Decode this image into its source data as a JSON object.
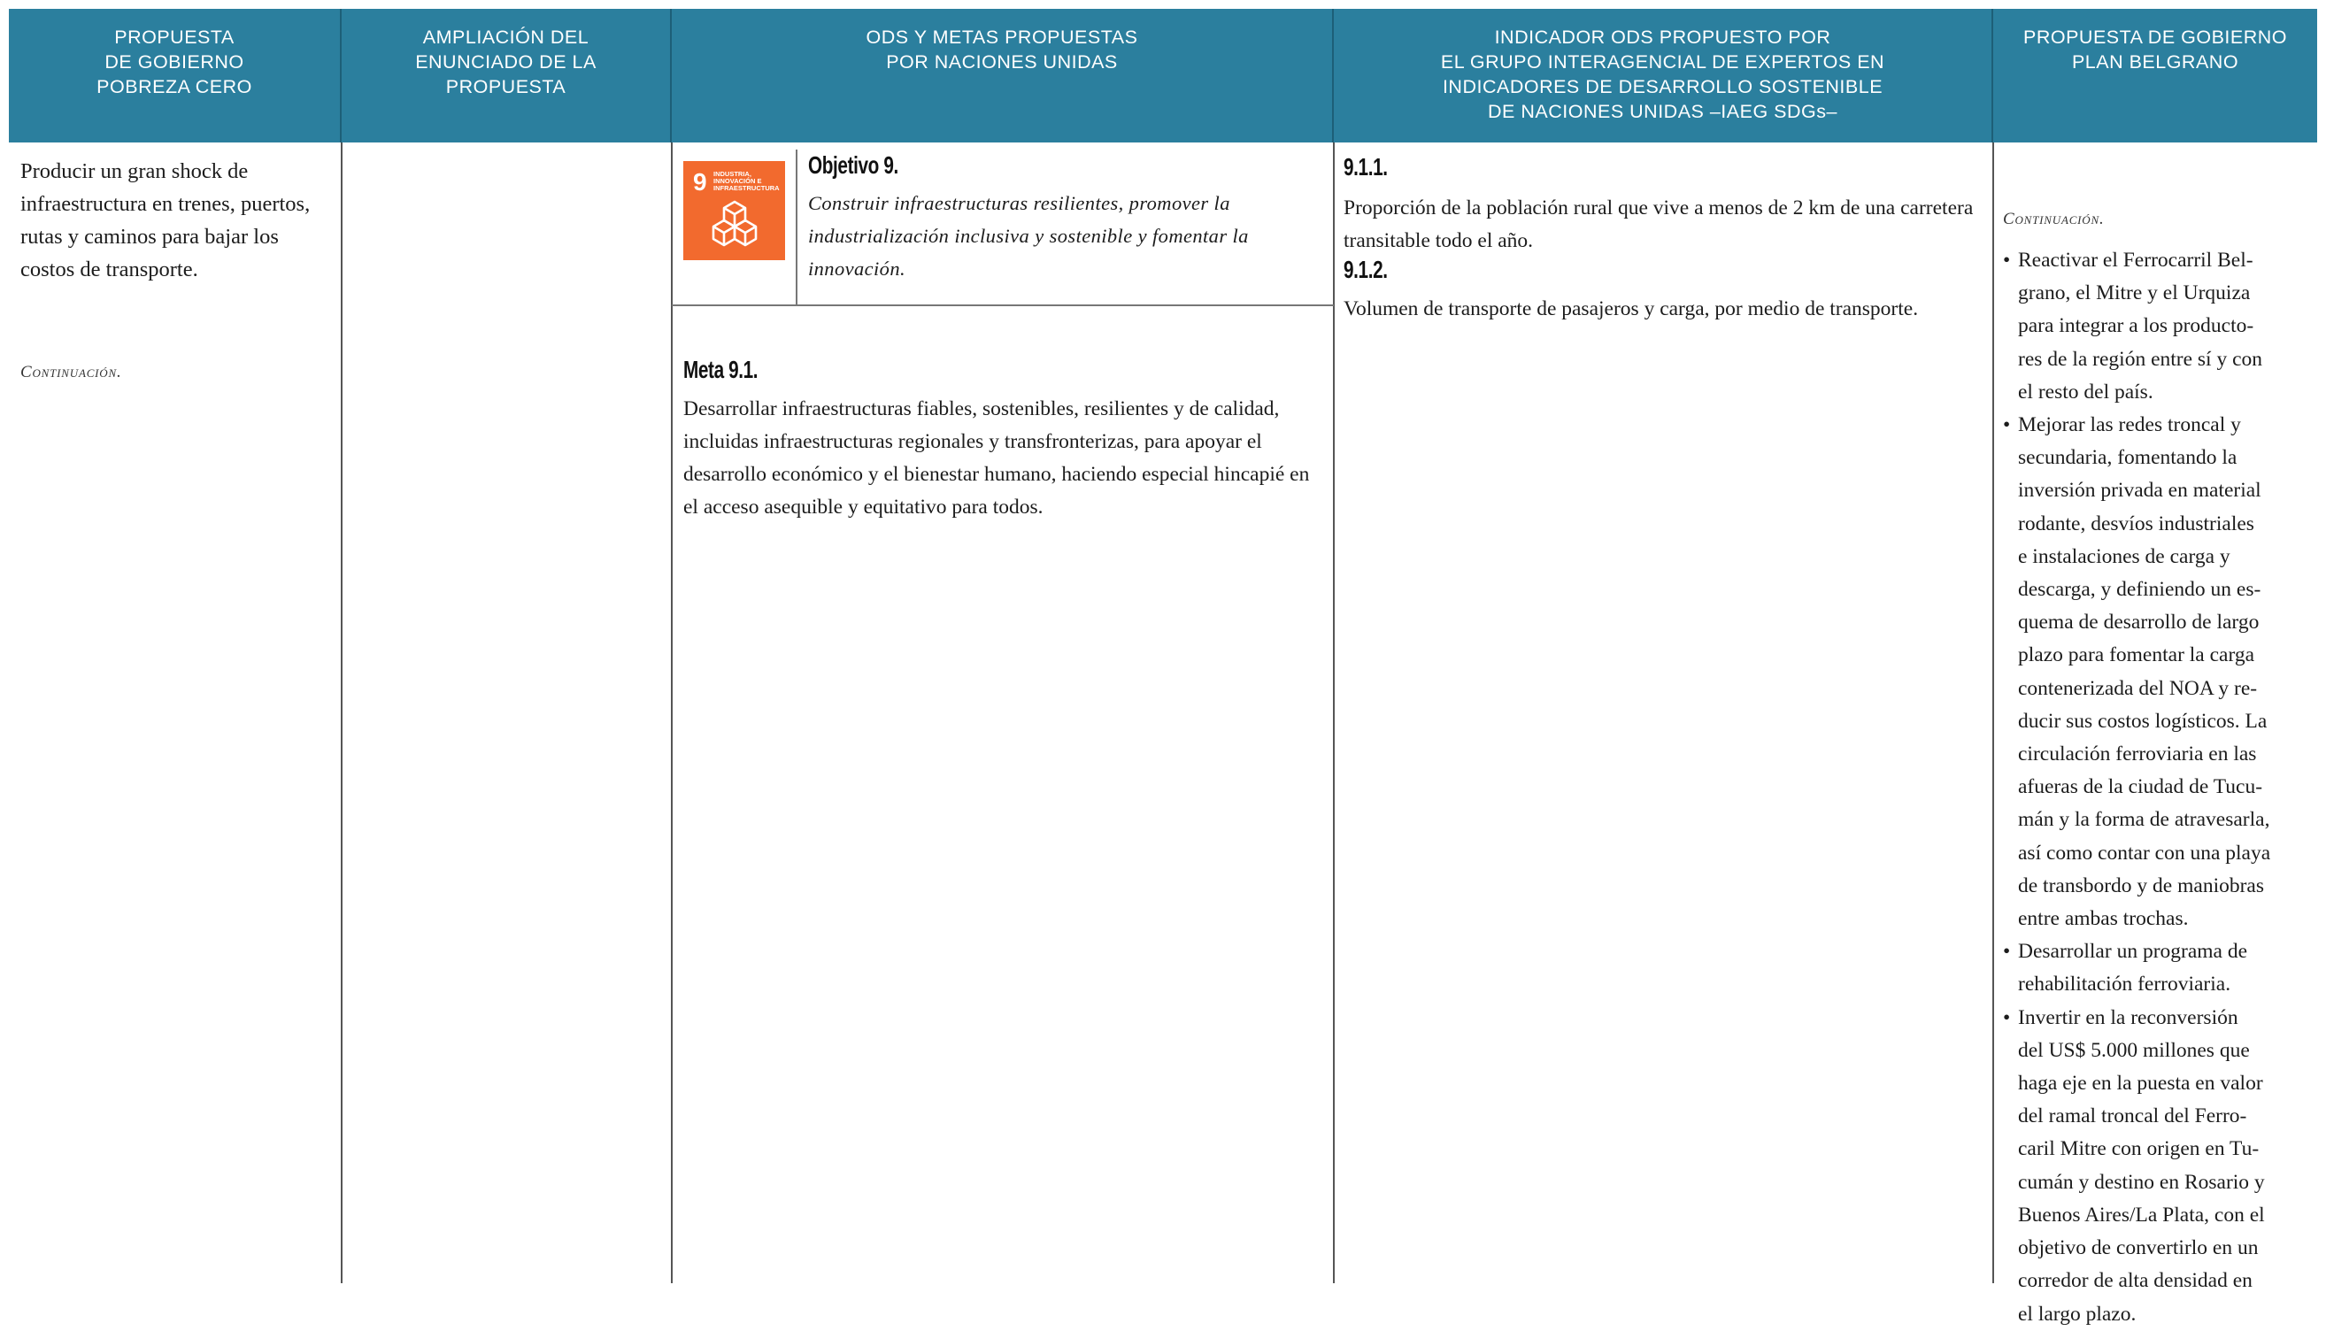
{
  "headers": [
    [
      "PROPUESTA",
      "DE GOBIERNO",
      "POBREZA CERO"
    ],
    [
      "AMPLIACIÓN DEL",
      "ENUNCIADO DE LA",
      "PROPUESTA"
    ],
    [
      "ODS Y METAS PROPUESTAS",
      "POR NACIONES UNIDAS"
    ],
    [
      "INDICADOR ODS PROPUESTO POR",
      "EL GRUPO INTERAGENCIAL DE EXPERTOS EN",
      "INDICADORES DE DESARROLLO SOSTENIBLE",
      "DE NACIONES UNIDAS –IAEG SDGs–"
    ],
    [
      "PROPUESTA DE GOBIERNO",
      "PLAN BELGRANO"
    ]
  ],
  "col1": {
    "text": "Producir un gran shock de infraestructura en trenes, puertos, rutas y caminos para bajar los costos de transporte.",
    "continuation": "Continuación."
  },
  "col2": {},
  "col3": {
    "sdg_icon": {
      "number": "9",
      "caption": "Industria, innovación e infraestructura",
      "color": "#f26a2e",
      "icon": "cubes-icon"
    },
    "objective_title": "Objetivo 9.",
    "objective_text": "Construir infraestructuras resilientes, promover la industrialización inclusiva y sostenible y fomentar la innovación.",
    "meta_title": "Meta 9.1.",
    "meta_text": "Desarrollar infraestructuras fiables, sostenibles, resilientes y de calidad, incluidas infraestructuras regionales y transfronterizas, para apoyar el desarrollo económico y el bienestar humano, haciendo especial hincapié en el acceso asequible y equitativo para todos."
  },
  "col4": {
    "indicators": [
      {
        "code": "9.1.1.",
        "text": "Proporción de la población rural que vive a menos de 2 km de una carretera transitable todo el año."
      },
      {
        "code": "9.1.2.",
        "text": "Volumen de transporte de pasajeros y carga, por medio de transporte."
      }
    ]
  },
  "col5": {
    "continuation": "Continuación.",
    "bullets": [
      [
        "Reactivar el Ferrocarril Bel-",
        "grano, el Mitre y el Urquiza",
        "para integrar a los producto-",
        "res de la región entre sí y con",
        "el resto del país."
      ],
      [
        "Mejorar  las redes troncal y",
        "secundaria, fomentando la",
        "inversión privada en material",
        "rodante, desvíos industriales",
        "e instalaciones de carga y",
        "descarga, y definiendo un es-",
        "quema de desarrollo de largo",
        "plazo para fomentar la carga",
        "contenerizada del NOA y re-",
        "ducir sus costos logísticos. La",
        "circulación ferroviaria en las",
        "afueras de la ciudad de Tucu-",
        "mán y la forma de atravesarla,",
        "así como contar con una playa",
        "de transbordo y de maniobras",
        "entre ambas trochas."
      ],
      [
        "Desarrollar  un programa de",
        "rehabilitación ferroviaria."
      ],
      [
        "Invertir en la reconversión",
        "del US$ 5.000 millones que",
        "haga eje en la puesta en valor",
        "del ramal troncal del Ferro-",
        "caril Mitre con origen en Tu-",
        "cumán y destino en Rosario y",
        "Buenos Aires/La Plata, con el",
        "objetivo de convertirlo en un",
        "corredor de alta densidad en",
        "el largo plazo."
      ]
    ]
  },
  "colors": {
    "header_bg": "#2b7f9e",
    "header_text": "#ffffff",
    "body_text": "#1c1c1c"
  }
}
